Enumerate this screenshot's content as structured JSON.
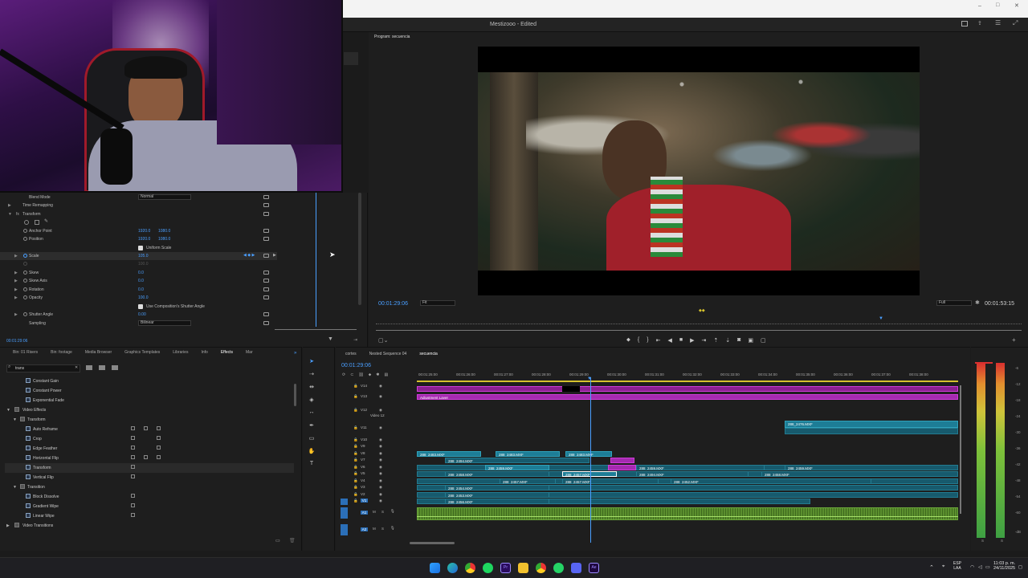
{
  "window": {
    "title": "Mestizooo - Edited"
  },
  "effect_controls": {
    "timecode": "00:01:29:06",
    "rows": [
      {
        "label": "Blend Mode",
        "value": "Normal"
      },
      {
        "label": "Time Remapping"
      },
      {
        "label": "Transform"
      },
      {
        "label": "Anchor Point",
        "v1": "1920.0",
        "v2": "1080.0"
      },
      {
        "label": "Position",
        "v1": "1920.0",
        "v2": "1080.0"
      },
      {
        "label": "Uniform Scale"
      },
      {
        "label": "Scale",
        "v1": "105.0"
      },
      {
        "label": "",
        "v1": "100.0"
      },
      {
        "label": "Skew",
        "v1": "0.0"
      },
      {
        "label": "Skew Axis",
        "v1": "0.0"
      },
      {
        "label": "Rotation",
        "v1": "0.0"
      },
      {
        "label": "Opacity",
        "v1": "100.0"
      },
      {
        "label": "Use Composition's Shutter Angle"
      },
      {
        "label": "Shutter Angle",
        "v1": "0.00"
      },
      {
        "label": "Sampling",
        "value": "Bilinear"
      }
    ]
  },
  "program": {
    "tab": "Program: secuencia",
    "timecode_left": "00:01:29:06",
    "fit": "Fit",
    "quality": "Full",
    "timecode_right": "00:01:53:15"
  },
  "effects_panel": {
    "tabs": [
      "Bin: 01 Risers",
      "Bin: footage",
      "Media Browser",
      "Graphics Templates",
      "Libraries",
      "Info",
      "Effects",
      "Mar"
    ],
    "search": "trans",
    "items": [
      {
        "name": "Constant Gain",
        "level": 2
      },
      {
        "name": "Constant Power",
        "level": 2
      },
      {
        "name": "Exponential Fade",
        "level": 2
      },
      {
        "name": "Video Effects",
        "level": 0
      },
      {
        "name": "Transform",
        "level": 1
      },
      {
        "name": "Auto Reframe",
        "level": 2
      },
      {
        "name": "Crop",
        "level": 2
      },
      {
        "name": "Edge Feather",
        "level": 2
      },
      {
        "name": "Horizontal Flip",
        "level": 2
      },
      {
        "name": "Transform",
        "level": 2
      },
      {
        "name": "Vertical Flip",
        "level": 2
      },
      {
        "name": "Transition",
        "level": 1
      },
      {
        "name": "Block Dissolve",
        "level": 2
      },
      {
        "name": "Gradient Wipe",
        "level": 2
      },
      {
        "name": "Linear Wipe",
        "level": 2
      },
      {
        "name": "Video Transitions",
        "level": 0
      }
    ]
  },
  "timeline": {
    "tabs": [
      "cortes",
      "Nested Sequence 04",
      "secuencia"
    ],
    "timecode": "00:01:29:06",
    "ruler": [
      "00:01:25:00",
      "00:01:26:00",
      "00:01:27:00",
      "00:01:28:00",
      "00:01:29:00",
      "00:01:30:00",
      "00:01:31:00",
      "00:01:32:00",
      "00:01:33:00",
      "00:01:34:00",
      "00:01:35:00",
      "00:01:36:00",
      "00:01:37:00",
      "00:01:38:00"
    ],
    "tracks": [
      "V14",
      "V13",
      "V12",
      "V11",
      "V10",
      "V9",
      "V8",
      "V7",
      "V6",
      "V5",
      "V4",
      "V3",
      "V2",
      "V1",
      "A1",
      "A2"
    ],
    "track_name_v12": "Video 12",
    "clips": {
      "adjustment": "Adjustment Layer",
      "c2476": "288_2476.MXF",
      "c2483": "288_2483.MXF",
      "c2494": "288_2494.MXF",
      "c2459": "288_2459.MXF",
      "c2458": "288_2458.MXF",
      "c2457": "288_2457.MXF",
      "c2454": "288_2454.MXF",
      "c2453": "288_2453.MXF",
      "c2456": "288_2456.MXF",
      "c2452": "288_2452.MXF"
    }
  },
  "meter": {
    "labels": [
      "-6",
      "-12",
      "-18",
      "-24",
      "-30",
      "-36",
      "-42",
      "-48",
      "-54",
      "-60",
      "-dB"
    ],
    "bottom": [
      "S",
      "S"
    ]
  },
  "taskbar": {
    "lang1": "ESP",
    "lang2": "LAA",
    "time": "11:03 p. m.",
    "date": "24/11/2025"
  }
}
